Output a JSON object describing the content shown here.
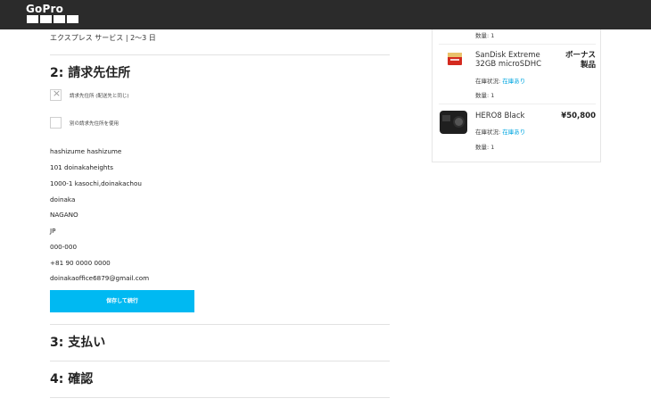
{
  "header": {
    "logo_text": "GoPro"
  },
  "shipping": {
    "method_note": "エクスプレス サービス | 2〜3 日"
  },
  "billing": {
    "title": "2: 請求先住所",
    "same_as_shipping_label": "請求先住所 (配送先と同じ)",
    "use_other_label": "別の請求先住所を使用",
    "address_lines": [
      "hashizume hashizume",
      "101 doinakaheights",
      "1000-1 kasochi,doinakachou",
      "doinaka",
      "NAGANO",
      "JP",
      "000-000",
      "+81 90 0000 0000",
      "doinakaoffice6879@gmail.com"
    ],
    "save_button_label": "保存して続行"
  },
  "payment": {
    "title": "3: 支払い"
  },
  "confirm": {
    "title": "4: 確認"
  },
  "cart": {
    "top_qty": "数量: 1",
    "items": [
      {
        "name_line1": "SanDisk Extreme",
        "name_line2": "32GB microSDHC",
        "price_line1": "ボーナス",
        "price_line2": "製品",
        "stock_label": "在庫状況: ",
        "stock_value": "在庫あり",
        "qty": "数量: 1"
      },
      {
        "name": "HERO8 Black",
        "price": "¥50,800",
        "stock_label": "在庫状況: ",
        "stock_value": "在庫あり",
        "qty": "数量: 1"
      }
    ]
  },
  "colors": {
    "accent": "#00b9f2",
    "header_bg": "#2b2b2b",
    "stock_in": "#00a6e0"
  }
}
